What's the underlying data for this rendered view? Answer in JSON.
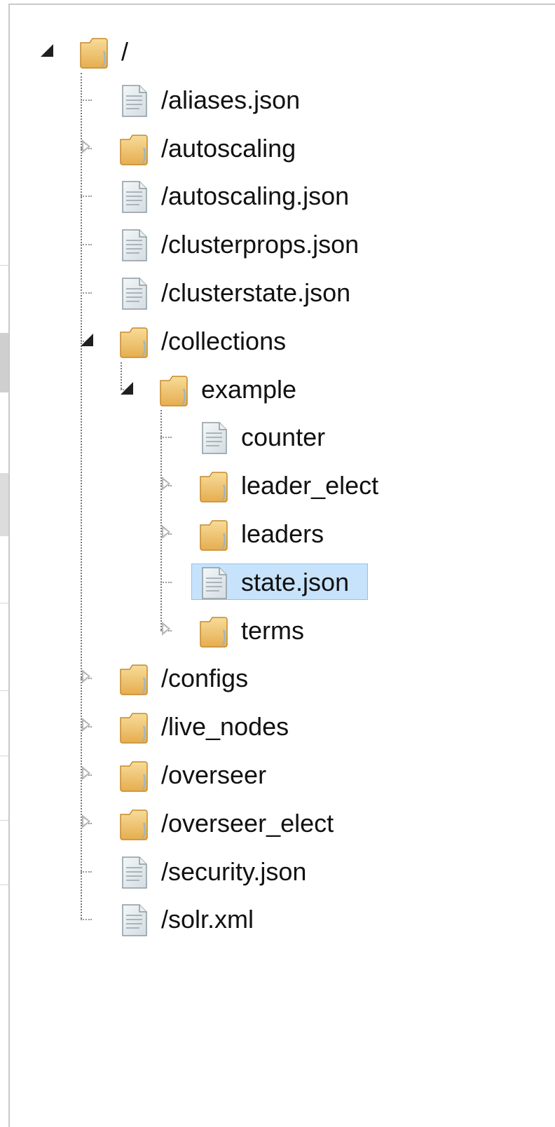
{
  "tree": {
    "root": {
      "label": "/",
      "icon": "folder-icon",
      "expanded": true
    },
    "children": [
      {
        "label": "/aliases.json",
        "icon": "file-icon"
      },
      {
        "label": "/autoscaling",
        "icon": "folder-icon",
        "expanded": false
      },
      {
        "label": "/autoscaling.json",
        "icon": "file-icon"
      },
      {
        "label": "/clusterprops.json",
        "icon": "file-icon"
      },
      {
        "label": "/clusterstate.json",
        "icon": "file-icon"
      },
      {
        "label": "/collections",
        "icon": "folder-icon",
        "expanded": true,
        "children": [
          {
            "label": "example",
            "icon": "folder-icon",
            "expanded": true,
            "children": [
              {
                "label": "counter",
                "icon": "file-icon"
              },
              {
                "label": "leader_elect",
                "icon": "folder-icon",
                "expanded": false
              },
              {
                "label": "leaders",
                "icon": "folder-icon",
                "expanded": false
              },
              {
                "label": "state.json",
                "icon": "file-icon",
                "selected": true
              },
              {
                "label": "terms",
                "icon": "folder-icon",
                "expanded": false
              }
            ]
          }
        ]
      },
      {
        "label": "/configs",
        "icon": "folder-icon",
        "expanded": false
      },
      {
        "label": "/live_nodes",
        "icon": "folder-icon",
        "expanded": false
      },
      {
        "label": "/overseer",
        "icon": "folder-icon",
        "expanded": false
      },
      {
        "label": "/overseer_elect",
        "icon": "folder-icon",
        "expanded": false
      },
      {
        "label": "/security.json",
        "icon": "file-icon"
      },
      {
        "label": "/solr.xml",
        "icon": "file-icon"
      }
    ]
  },
  "colors": {
    "selection_bg": "#c7e3fb",
    "selection_border": "#8ec3ef",
    "folder": "#f1c46e",
    "file": "#dfe6ea"
  }
}
